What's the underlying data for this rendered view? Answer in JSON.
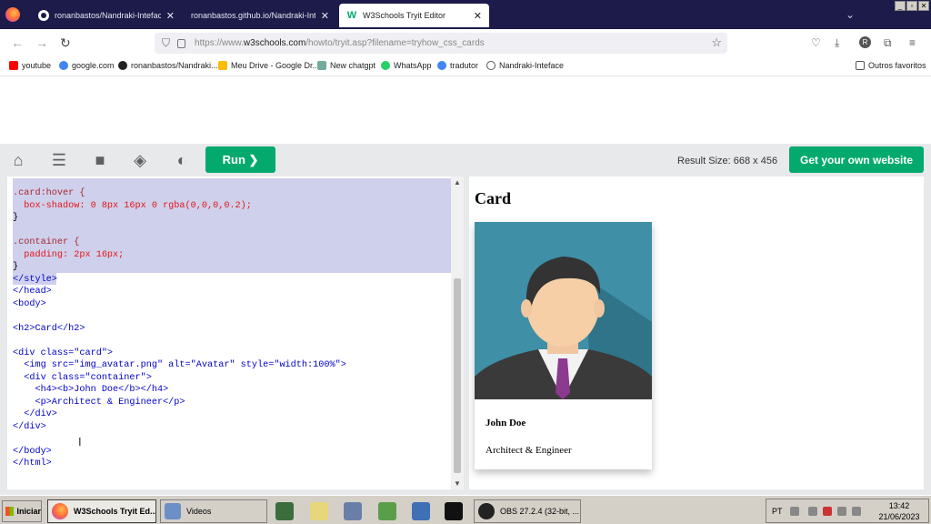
{
  "browser": {
    "tabs": [
      {
        "title": "ronanbastos/Nandraki-Inteface: In",
        "icon": "github-icon",
        "active": false
      },
      {
        "title": "ronanbastos.github.io/Nandraki-Intefa",
        "icon": "page-icon",
        "active": false
      },
      {
        "title": "W3Schools Tryit Editor",
        "icon": "w3schools-icon",
        "active": true
      }
    ],
    "tab_close_glyph": "✕",
    "url_prefix": "https://www.",
    "url_domain": "w3schools.com",
    "url_rest": "/howto/tryit.asp?filename=tryhow_css_cards",
    "profile_initial": "R"
  },
  "bookmarks": [
    {
      "label": "youtube",
      "color": "#ff0000"
    },
    {
      "label": "google.com",
      "color": "#4285f4"
    },
    {
      "label": "ronanbastos/Nandraki...",
      "color": "#222222"
    },
    {
      "label": "Meu Drive - Google Dr...",
      "color": "#fbbc04"
    },
    {
      "label": "New chatgpt",
      "color": "#74aa9c"
    },
    {
      "label": "WhatsApp",
      "color": "#25d366"
    },
    {
      "label": "tradutor",
      "color": "#4285f4"
    },
    {
      "label": "Nandraki-Inteface",
      "color": "#555555"
    }
  ],
  "other_bookmarks": "Outros favoritos",
  "tryit": {
    "run_label": "Run ❯",
    "result_size": "Result Size: 668 x 456",
    "get_website": "Get your own website",
    "accent": "#04aa6d"
  },
  "code_lines": [
    ".card:hover {",
    "  box-shadow: 0 8px 16px 0 rgba(0,0,0,0.2);",
    "}",
    "",
    ".container {",
    "  padding: 2px 16px;",
    "}",
    "</style>",
    "</head>",
    "<body>",
    "",
    "<h2>Card</h2>",
    "",
    "<div class=\"card\">",
    "  <img src=\"img_avatar.png\" alt=\"Avatar\" style=\"width:100%\">",
    "  <div class=\"container\">",
    "    <h4><b>John Doe</b></h4>",
    "    <p>Architect & Engineer</p>",
    "  </div>",
    "</div>",
    "",
    "</body>",
    "</html>"
  ],
  "result": {
    "heading": "Card",
    "name": "John Doe",
    "role": "Architect & Engineer"
  },
  "taskbar": {
    "start": "Iniciar",
    "tasks": [
      {
        "label": "W3Schools Tryit Ed...",
        "active": true
      },
      {
        "label": "Videos",
        "active": false
      },
      {
        "label": "OBS 27.2.4 (32-bit, ...",
        "active": false
      }
    ],
    "lang": "PT",
    "time": "13:42",
    "date": "21/06/2023"
  }
}
